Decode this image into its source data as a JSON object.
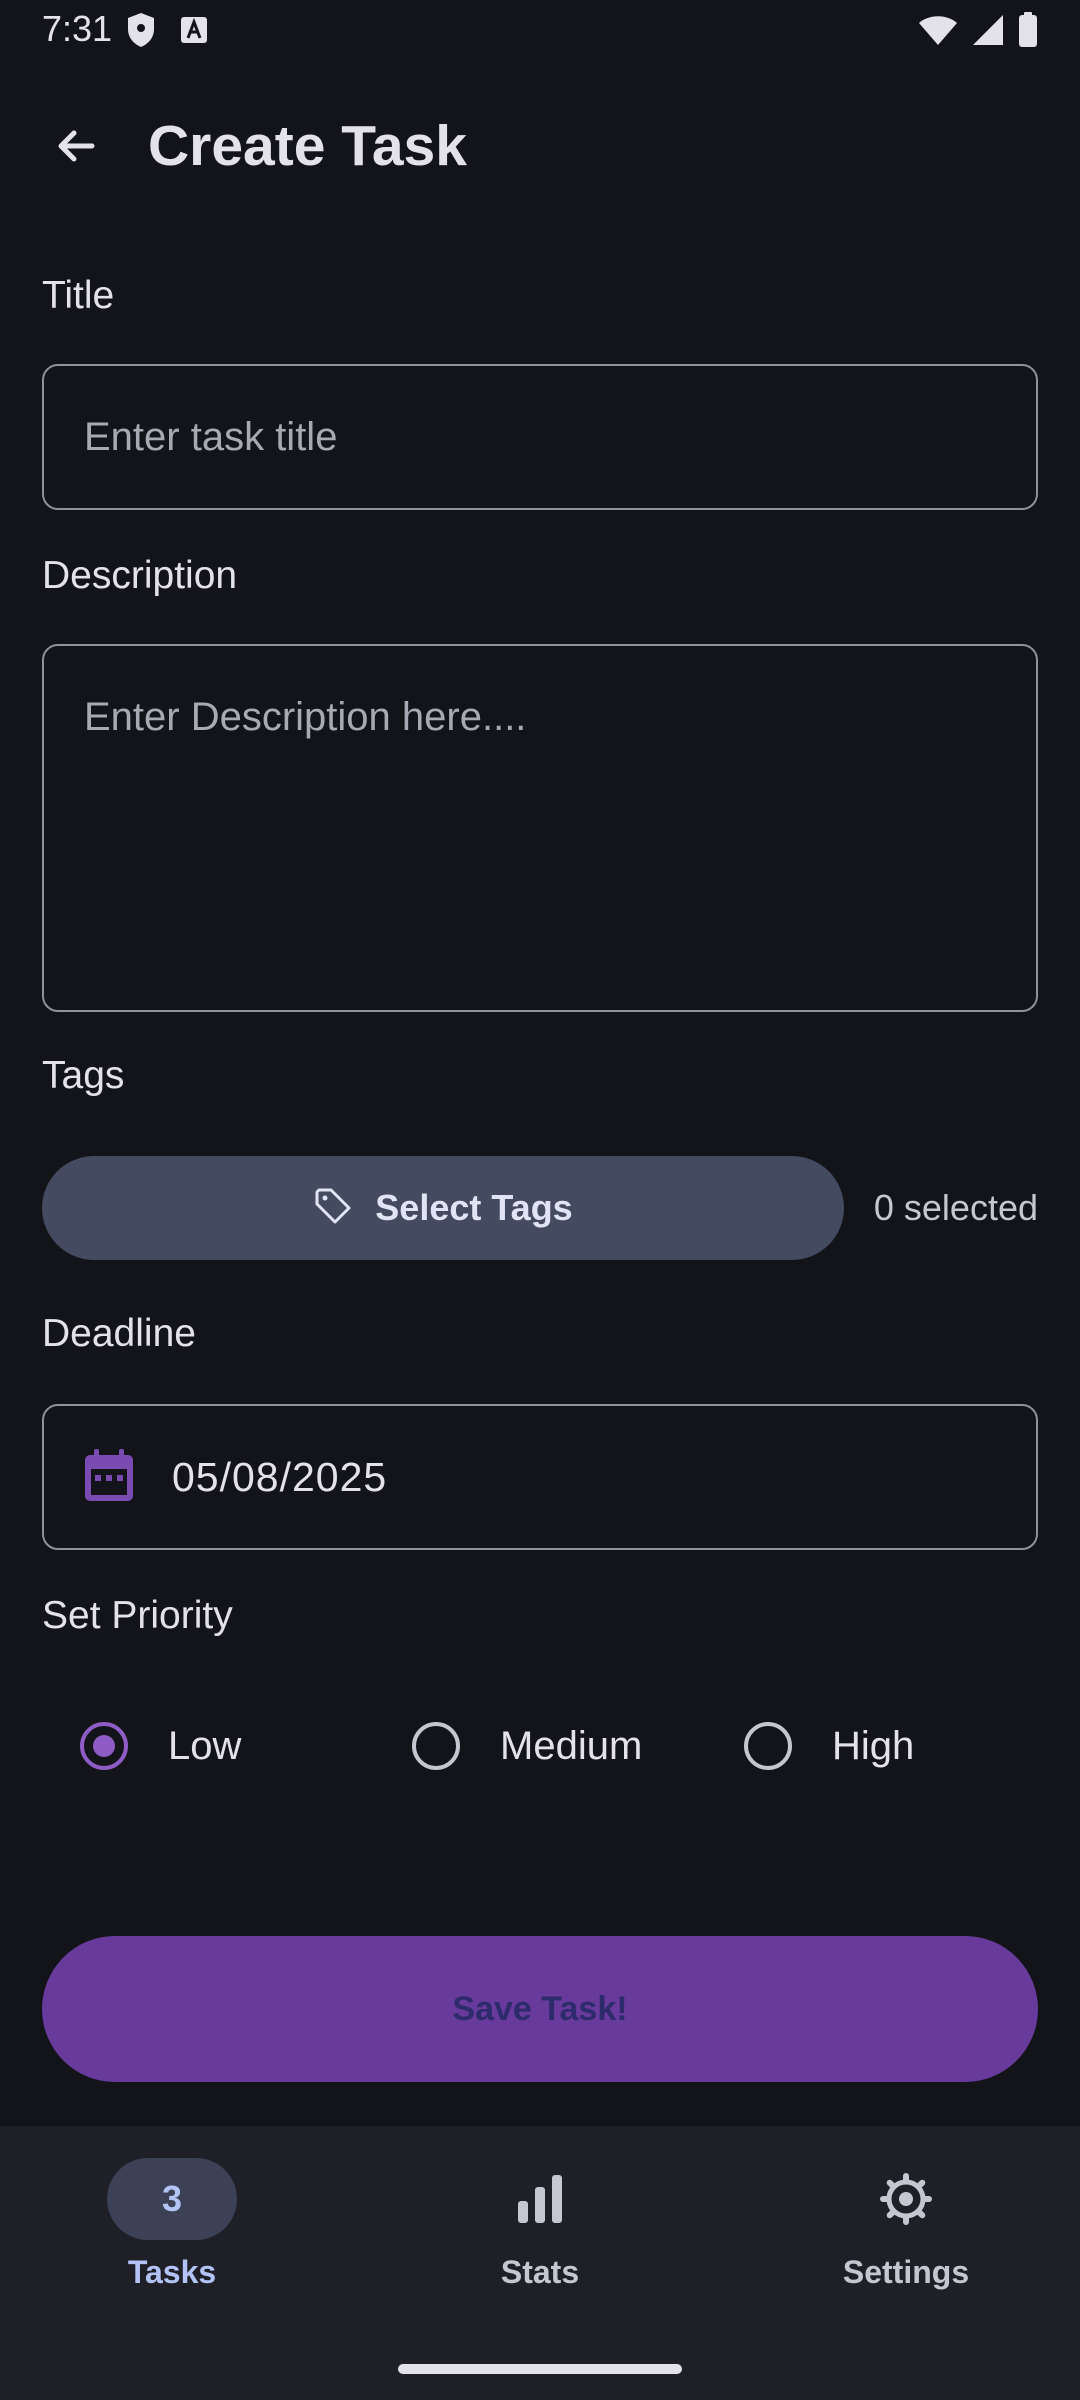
{
  "status_bar": {
    "time": "7:31",
    "left_icons": [
      "shield-icon",
      "a-badge-icon"
    ],
    "right_icons": [
      "wifi-icon",
      "signal-icon",
      "battery-icon"
    ]
  },
  "app_bar": {
    "title": "Create Task",
    "back_icon": "arrow-left-icon"
  },
  "form": {
    "title": {
      "label": "Title",
      "placeholder": "Enter task title",
      "value": ""
    },
    "description": {
      "label": "Description",
      "placeholder": "Enter Description here....",
      "value": ""
    },
    "tags": {
      "label": "Tags",
      "button_label": "Select Tags",
      "button_icon": "tag-icon",
      "count_text": "0 selected"
    },
    "deadline": {
      "label": "Deadline",
      "value": "05/08/2025",
      "icon": "calendar-icon"
    },
    "priority": {
      "label": "Set Priority",
      "options": [
        {
          "label": "Low",
          "selected": true
        },
        {
          "label": "Medium",
          "selected": false
        },
        {
          "label": "High",
          "selected": false
        }
      ]
    },
    "save_label": "Save Task!"
  },
  "bottom_nav": {
    "items": [
      {
        "label": "Tasks",
        "badge": "3",
        "active": true
      },
      {
        "label": "Stats",
        "icon": "bar-chart-icon",
        "active": false
      },
      {
        "label": "Settings",
        "icon": "settings-icon",
        "active": false
      }
    ]
  },
  "colors": {
    "background": "#13141a",
    "accent": "#673a9b",
    "radio_selected": "#8f5cc6",
    "tag_button": "#444a5f",
    "nav_background": "#1f2027",
    "nav_active": "#b3c3f5"
  }
}
